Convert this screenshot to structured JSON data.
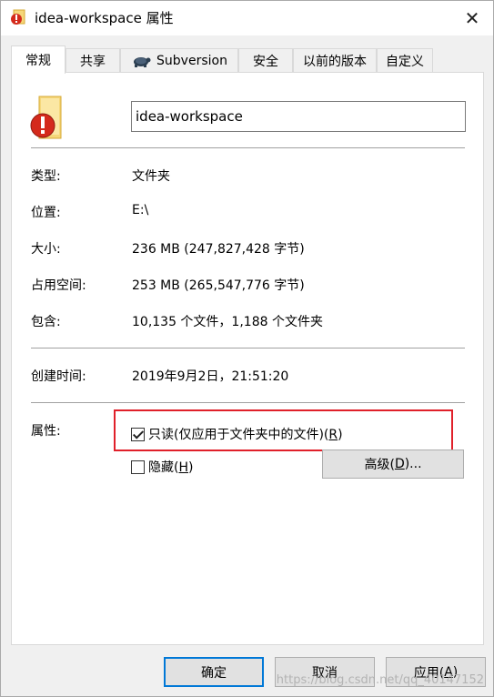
{
  "window": {
    "title": "idea-workspace 属性",
    "close_glyph": "✕"
  },
  "tabs": [
    {
      "label": "常规",
      "active": true
    },
    {
      "label": "共享"
    },
    {
      "label": "Subversion"
    },
    {
      "label": "安全"
    },
    {
      "label": "以前的版本"
    },
    {
      "label": "自定义"
    }
  ],
  "general": {
    "folder_name": "idea-workspace",
    "rows": [
      {
        "label": "类型:",
        "value": "文件夹"
      },
      {
        "label": "位置:",
        "value": "E:\\"
      },
      {
        "label": "大小:",
        "value": "236 MB (247,827,428 字节)"
      },
      {
        "label": "占用空间:",
        "value": "253 MB (265,547,776 字节)"
      },
      {
        "label": "包含:",
        "value": "10,135 个文件，1,188 个文件夹"
      },
      {
        "label": "创建时间:",
        "value": "2019年9月2日，21:51:20"
      }
    ],
    "attributes_label": "属性:",
    "readonly": {
      "text": "只读(仅应用于文件夹中的文件)(",
      "key": "R",
      "end": ")",
      "checked": true
    },
    "hidden": {
      "text": "隐藏(",
      "key": "H",
      "end": ")",
      "checked": false
    },
    "advanced": {
      "text": "高级(",
      "key": "D",
      "end": ")..."
    }
  },
  "buttons": {
    "ok": "确定",
    "cancel": "取消",
    "apply_text": "应用(",
    "apply_key": "A",
    "apply_end": ")"
  },
  "watermark": "https://blog.csdn.net/qq_40147152",
  "colors": {
    "highlight": "#e0202a",
    "default_button_border": "#0078d7"
  },
  "icons": {
    "title": "folder-with-svn-conflict-icon",
    "folder": "folder-with-svn-conflict-icon",
    "subversion_tab": "tortoise-svn-icon"
  }
}
